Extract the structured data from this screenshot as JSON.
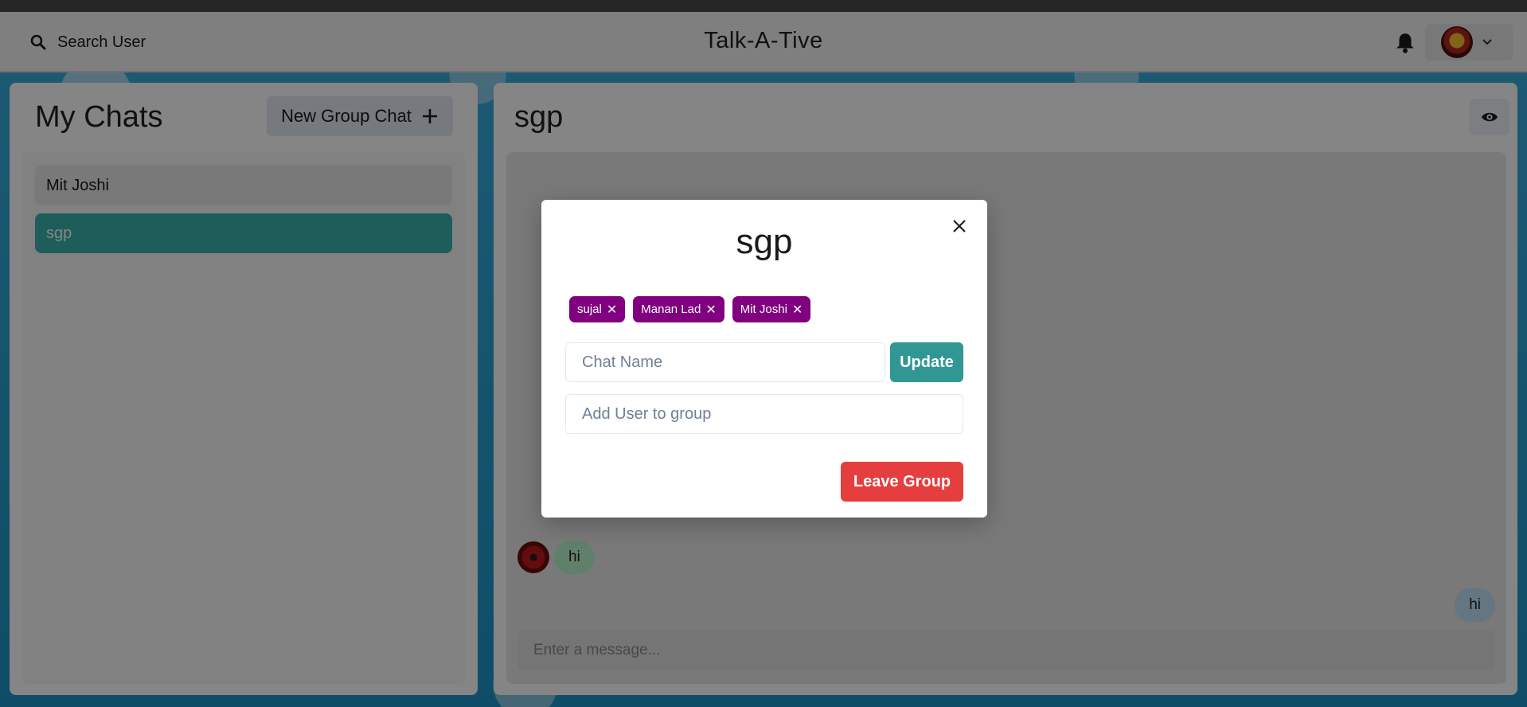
{
  "header": {
    "search_label": "Search User",
    "app_title": "Talk-A-Tive"
  },
  "sidebar": {
    "title": "My Chats",
    "new_group_label": "New Group Chat",
    "chats": [
      {
        "name": "Mit Joshi",
        "selected": false
      },
      {
        "name": "sgp",
        "selected": true
      }
    ]
  },
  "chat": {
    "title": "sgp",
    "messages": [
      {
        "text": "hi",
        "from": "other"
      },
      {
        "text": "hi",
        "from": "self"
      }
    ],
    "input_placeholder": "Enter a message..."
  },
  "modal": {
    "title": "sgp",
    "members": [
      "sujal",
      "Manan Lad",
      "Mit Joshi"
    ],
    "chat_name_placeholder": "Chat Name",
    "update_label": "Update",
    "add_user_placeholder": "Add User to group",
    "leave_label": "Leave Group"
  },
  "colors": {
    "accent": "#38b2ac",
    "chip": "#800080",
    "danger": "#e53e3e",
    "update": "#319795"
  },
  "icons": {
    "search": "search-icon",
    "bell": "bell-icon",
    "chevron": "chevron-down-icon",
    "plus": "plus-icon",
    "eye": "eye-icon",
    "close": "close-icon"
  }
}
